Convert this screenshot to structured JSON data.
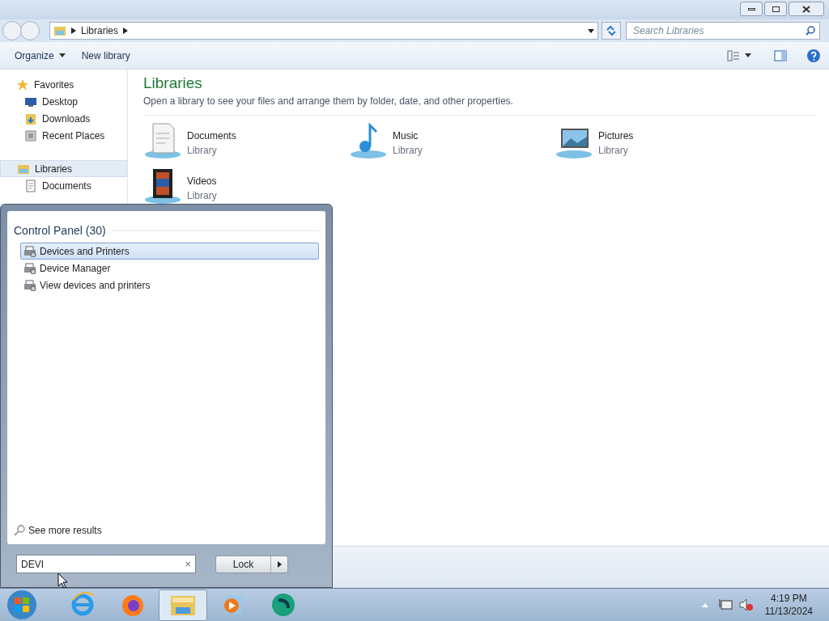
{
  "address_bar": {
    "breadcrumb": [
      "Libraries"
    ],
    "search_placeholder": "Search Libraries"
  },
  "toolbar": {
    "buttons": [
      "Organize",
      "New library"
    ]
  },
  "sidebar": {
    "groups": [
      {
        "label": "Favorites",
        "kind": "star",
        "selected": false,
        "items": [
          {
            "label": "Desktop",
            "kind": "desktop"
          },
          {
            "label": "Downloads",
            "kind": "downloads"
          },
          {
            "label": "Recent Places",
            "kind": "recent"
          }
        ]
      },
      {
        "label": "Libraries",
        "kind": "libraries",
        "selected": true,
        "items": [
          {
            "label": "Documents",
            "kind": "document"
          }
        ]
      }
    ]
  },
  "content": {
    "title": "Libraries",
    "subtitle": "Open a library to see your files and arrange them by folder, date, and other properties.",
    "libraries": [
      {
        "name": "Documents",
        "type": "Library",
        "kind": "documents"
      },
      {
        "name": "Music",
        "type": "Library",
        "kind": "music"
      },
      {
        "name": "Pictures",
        "type": "Library",
        "kind": "pictures"
      },
      {
        "name": "Videos",
        "type": "Library",
        "kind": "videos"
      }
    ]
  },
  "start_menu": {
    "group": "Control Panel (30)",
    "results": [
      {
        "label": "Devices and Printers",
        "selected": true
      },
      {
        "label": "Device Manager",
        "selected": false
      },
      {
        "label": "View devices and printers",
        "selected": false
      }
    ],
    "see_more": "See more results",
    "search_value": "DEVI",
    "clear": "×",
    "power_button": "Lock"
  },
  "taskbar": {
    "apps": [
      {
        "kind": "ie",
        "active": false
      },
      {
        "kind": "firefox",
        "active": false
      },
      {
        "kind": "explorer",
        "active": true
      },
      {
        "kind": "media",
        "active": false
      },
      {
        "kind": "green",
        "active": false
      }
    ],
    "time": "4:19 PM",
    "date": "11/13/2024"
  }
}
